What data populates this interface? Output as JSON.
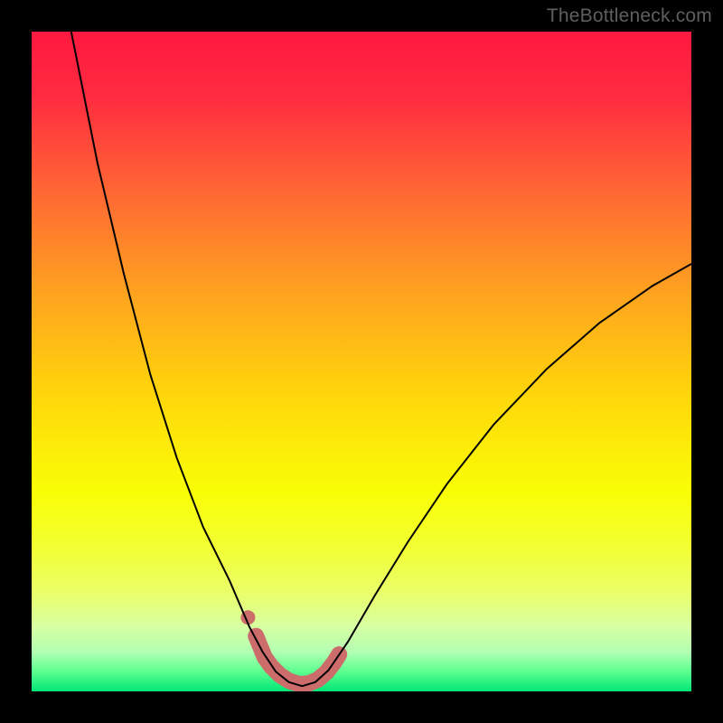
{
  "watermark": "TheBottleneck.com",
  "chart_data": {
    "type": "line",
    "title": "",
    "xlabel": "",
    "ylabel": "",
    "xlim": [
      0,
      100
    ],
    "ylim": [
      0,
      100
    ],
    "grid": false,
    "legend": false,
    "background_gradient_stops": [
      {
        "offset": 0.0,
        "color": "#ff183f"
      },
      {
        "offset": 0.1,
        "color": "#ff2c40"
      },
      {
        "offset": 0.25,
        "color": "#ff6a33"
      },
      {
        "offset": 0.4,
        "color": "#ffa41f"
      },
      {
        "offset": 0.55,
        "color": "#ffd60a"
      },
      {
        "offset": 0.7,
        "color": "#f9ff06"
      },
      {
        "offset": 0.78,
        "color": "#f2ff33"
      },
      {
        "offset": 0.85,
        "color": "#eaff69"
      },
      {
        "offset": 0.9,
        "color": "#d8ffa0"
      },
      {
        "offset": 0.94,
        "color": "#b3ffb3"
      },
      {
        "offset": 0.97,
        "color": "#5cff8f"
      },
      {
        "offset": 1.0,
        "color": "#00e676"
      }
    ],
    "series": [
      {
        "name": "bottleneck-curve",
        "color": "#000000",
        "stroke_width": 2,
        "points": [
          {
            "x": 6.0,
            "y": 100.0
          },
          {
            "x": 10.0,
            "y": 80.0
          },
          {
            "x": 14.0,
            "y": 63.2
          },
          {
            "x": 18.0,
            "y": 48.0
          },
          {
            "x": 22.0,
            "y": 35.4
          },
          {
            "x": 26.0,
            "y": 24.9
          },
          {
            "x": 30.0,
            "y": 16.8
          },
          {
            "x": 33.0,
            "y": 9.8
          },
          {
            "x": 35.0,
            "y": 6.0
          },
          {
            "x": 37.0,
            "y": 3.0
          },
          {
            "x": 39.0,
            "y": 1.4
          },
          {
            "x": 41.0,
            "y": 0.8
          },
          {
            "x": 43.0,
            "y": 1.4
          },
          {
            "x": 45.0,
            "y": 3.2
          },
          {
            "x": 48.0,
            "y": 7.6
          },
          {
            "x": 52.0,
            "y": 14.5
          },
          {
            "x": 57.0,
            "y": 22.6
          },
          {
            "x": 63.0,
            "y": 31.5
          },
          {
            "x": 70.0,
            "y": 40.4
          },
          {
            "x": 78.0,
            "y": 48.8
          },
          {
            "x": 86.0,
            "y": 55.8
          },
          {
            "x": 94.0,
            "y": 61.4
          },
          {
            "x": 100.0,
            "y": 64.8
          }
        ]
      },
      {
        "name": "highlight-band",
        "color": "#cc6d6c",
        "stroke_width": 18,
        "linecap": "round",
        "points": [
          {
            "x": 34.0,
            "y": 8.4
          },
          {
            "x": 35.3,
            "y": 5.2
          },
          {
            "x": 36.3,
            "y": 3.8
          },
          {
            "x": 37.6,
            "y": 2.5
          },
          {
            "x": 39.0,
            "y": 1.6
          },
          {
            "x": 40.5,
            "y": 1.1
          },
          {
            "x": 42.0,
            "y": 1.2
          },
          {
            "x": 43.4,
            "y": 1.8
          },
          {
            "x": 44.7,
            "y": 2.9
          },
          {
            "x": 45.8,
            "y": 4.3
          },
          {
            "x": 46.6,
            "y": 5.6
          }
        ]
      },
      {
        "name": "highlight-dot",
        "color": "#cc6d6c",
        "type_hint": "scatter",
        "radius": 8,
        "points": [
          {
            "x": 32.8,
            "y": 11.2
          }
        ]
      }
    ]
  }
}
